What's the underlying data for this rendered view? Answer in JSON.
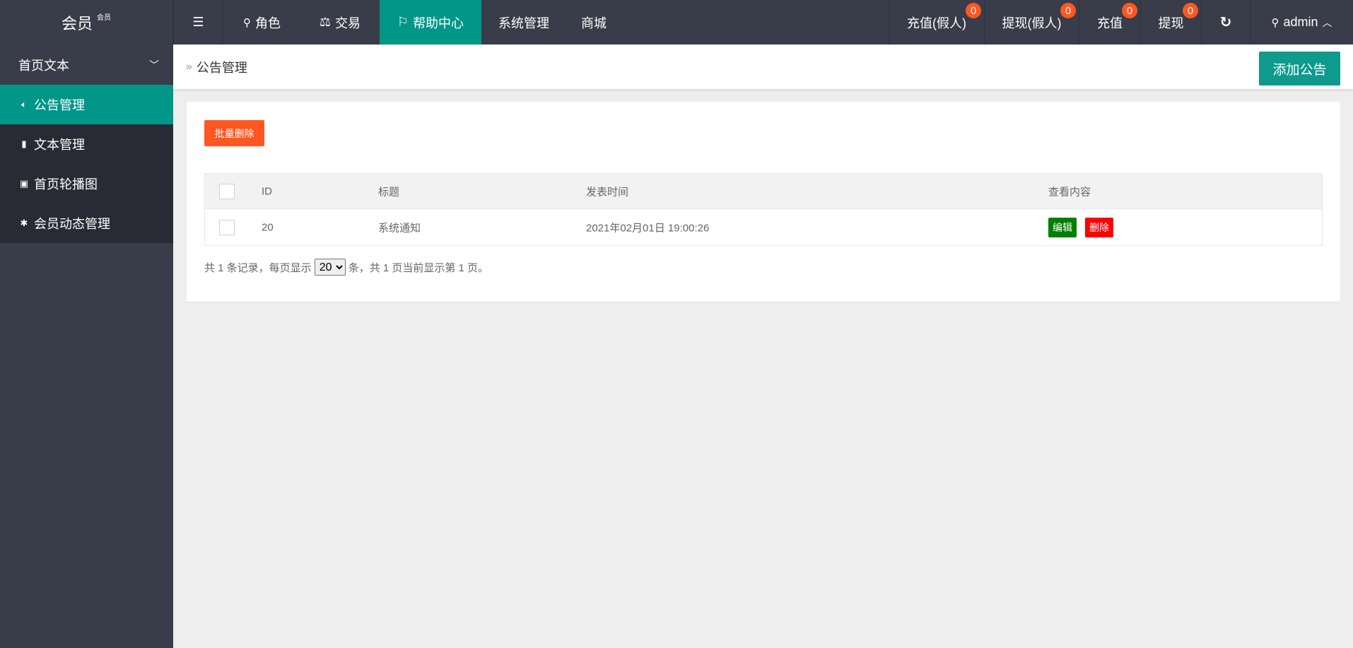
{
  "header": {
    "logo": "会员",
    "logo_sup": "会员",
    "nav": [
      {
        "label": "角色",
        "icon": "user-icon"
      },
      {
        "label": "交易",
        "icon": "scale-icon"
      },
      {
        "label": "帮助中心",
        "icon": "flag-icon",
        "active": true
      },
      {
        "label": "系统管理"
      },
      {
        "label": "商城"
      }
    ],
    "right": [
      {
        "label": "充值(假人)",
        "badge": "0"
      },
      {
        "label": "提现(假人)",
        "badge": "0"
      },
      {
        "label": "充值",
        "badge": "0"
      },
      {
        "label": "提现",
        "badge": "0"
      }
    ],
    "user": "admin"
  },
  "sidebar": {
    "group": "首页文本",
    "items": [
      {
        "label": "公告管理",
        "icon": "speaker-icon",
        "active": true
      },
      {
        "label": "文本管理",
        "icon": "book-icon"
      },
      {
        "label": "首页轮播图",
        "icon": "image-icon"
      },
      {
        "label": "会员动态管理",
        "icon": "tree-icon"
      }
    ]
  },
  "breadcrumb": "公告管理",
  "add_button": "添加公告",
  "bulk_delete": "批量删除",
  "table": {
    "headers": [
      "ID",
      "标题",
      "发表时间",
      "查看内容"
    ],
    "rows": [
      {
        "id": "20",
        "title": "系统通知",
        "time": "2021年02月01日 19:00:26",
        "edit": "编辑",
        "delete": "删除"
      }
    ]
  },
  "pager": {
    "prefix": "共 1 条记录，每页显示",
    "page_size": "20",
    "suffix": "条，共 1 页当前显示第 1 页。"
  },
  "colors": {
    "header": "#393d49",
    "accent": "#009688",
    "badge": "#ff5722"
  }
}
